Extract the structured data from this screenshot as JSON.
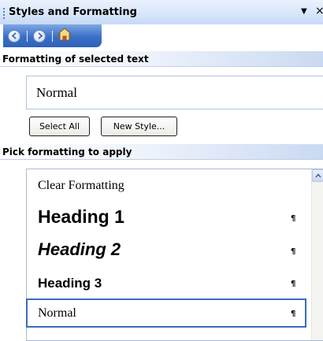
{
  "pane": {
    "title": "Styles and Formatting",
    "menu_arrow": "▼",
    "close_glyph": "×"
  },
  "toolbar": {
    "back_icon": "back-arrow-icon",
    "forward_icon": "forward-arrow-icon",
    "home_icon": "home-icon"
  },
  "selected_section": {
    "header": "Formatting of selected text",
    "current_style": "Normal"
  },
  "buttons": {
    "select_all": "Select All",
    "new_style": "New Style..."
  },
  "pick_section": {
    "header": "Pick formatting to apply",
    "items": [
      {
        "label": "Clear Formatting",
        "mark": ""
      },
      {
        "label": "Heading 1",
        "mark": "¶"
      },
      {
        "label": "Heading 2",
        "mark": "¶"
      },
      {
        "label": "Heading 3",
        "mark": "¶"
      },
      {
        "label": "Normal",
        "mark": "¶"
      }
    ],
    "selected_item": "Normal"
  },
  "colors": {
    "title_bar": "#d8e6fb",
    "toolbar": "#3a6fc7",
    "selection_border": "#3a6cc0"
  }
}
